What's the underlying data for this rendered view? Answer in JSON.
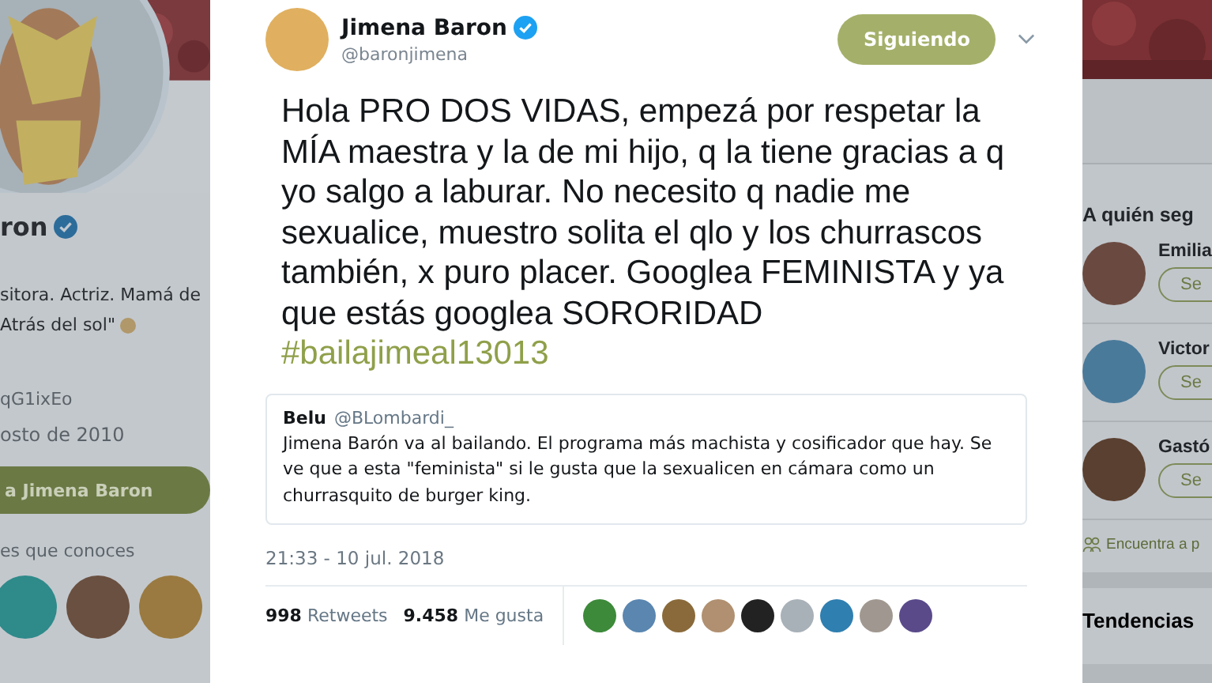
{
  "profile": {
    "name": "ron",
    "verified": true,
    "bio_lines": [
      "sitora. Actriz. Mamá de",
      "Atrás del sol\""
    ],
    "link": "qG1ixEo",
    "joined": "osto de 2010",
    "tweet_button": "a Jimena Baron",
    "followers_you_know": "es que conoces"
  },
  "tweet": {
    "author": "Jimena Baron",
    "verified": true,
    "handle": "@baronjimena",
    "follow_button": "Siguiendo",
    "text": "Hola PRO DOS VIDAS, empezá por respetar la MÍA maestra y la de mi hijo, q la tiene gracias a q yo salgo a laburar. No necesito q nadie me sexualice, muestro solita el qlo y los churrascos también, x puro placer. Googlea FEMINISTA y ya que estás googlea SORORIDAD",
    "hashtag": "#bailajimeal13013",
    "quote": {
      "author": "Belu",
      "handle": "@BLombardi_",
      "text": "Jimena Barón va al bailando. El programa más machista y cosificador que hay. Se ve que a esta \"feminista\" si le gusta que la sexualicen en cámara como un churrasquito de burger king."
    },
    "timestamp": "21:33 - 10 jul. 2018",
    "retweets": {
      "count": "998",
      "label": "Retweets"
    },
    "likes": {
      "count": "9.458",
      "label": "Me gusta"
    }
  },
  "who_to_follow": {
    "title": "A quién seg",
    "accounts": [
      {
        "name": "Emilia",
        "button": "Se"
      },
      {
        "name": "Victor",
        "button": "Se"
      },
      {
        "name": "Gastó",
        "button": "Se"
      }
    ]
  },
  "find_people": "Encuentra a p",
  "trends_title": "Tendencias"
}
